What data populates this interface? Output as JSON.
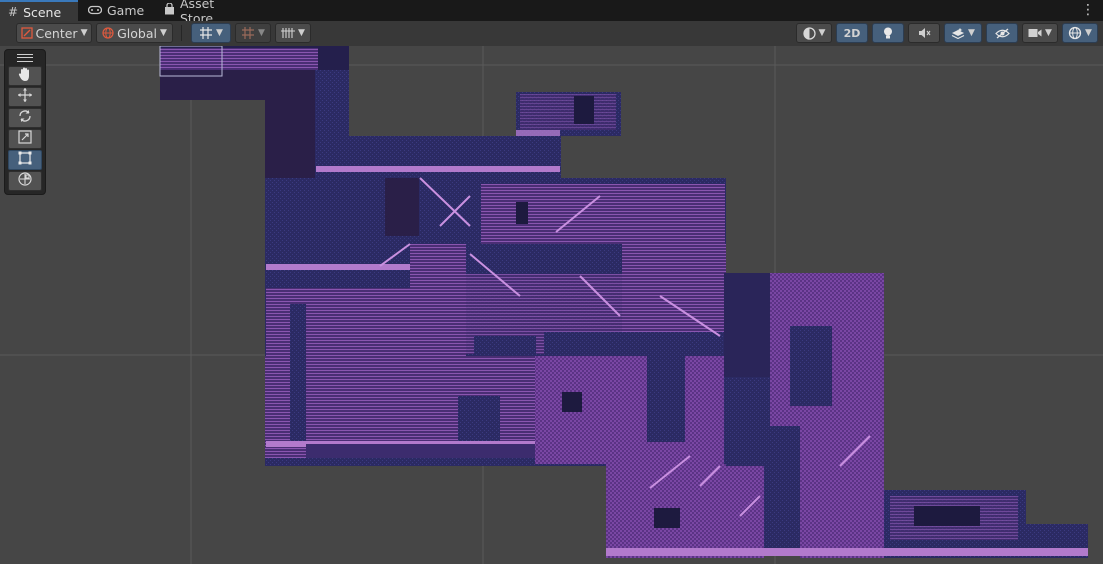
{
  "tabs": [
    {
      "label": "Scene",
      "icon": "hash-grid-icon",
      "active": true
    },
    {
      "label": "Game",
      "icon": "gamepad-icon",
      "active": false
    },
    {
      "label": "Asset Store",
      "icon": "shopping-bag-icon",
      "active": false
    }
  ],
  "toolbar": {
    "pivot_mode": "Center",
    "pivot_rotation": "Global",
    "mode_2d_label": "2D"
  },
  "colors": {
    "scene_background": "#464646",
    "tilemap_navy": "#2a2559",
    "tilemap_purple": "#6a3b8c",
    "tilemap_highlight": "#c990e0",
    "active_button": "#46607c"
  },
  "tools": [
    {
      "name": "hand-tool",
      "icon": "hand-icon",
      "selected": false
    },
    {
      "name": "move-tool",
      "icon": "move-arrows-icon",
      "selected": false
    },
    {
      "name": "rotate-tool",
      "icon": "rotate-icon",
      "selected": false
    },
    {
      "name": "scale-tool",
      "icon": "scale-icon",
      "selected": false
    },
    {
      "name": "rect-tool",
      "icon": "rect-transform-icon",
      "selected": true
    },
    {
      "name": "transform-tool",
      "icon": "transform-icon",
      "selected": false
    }
  ]
}
